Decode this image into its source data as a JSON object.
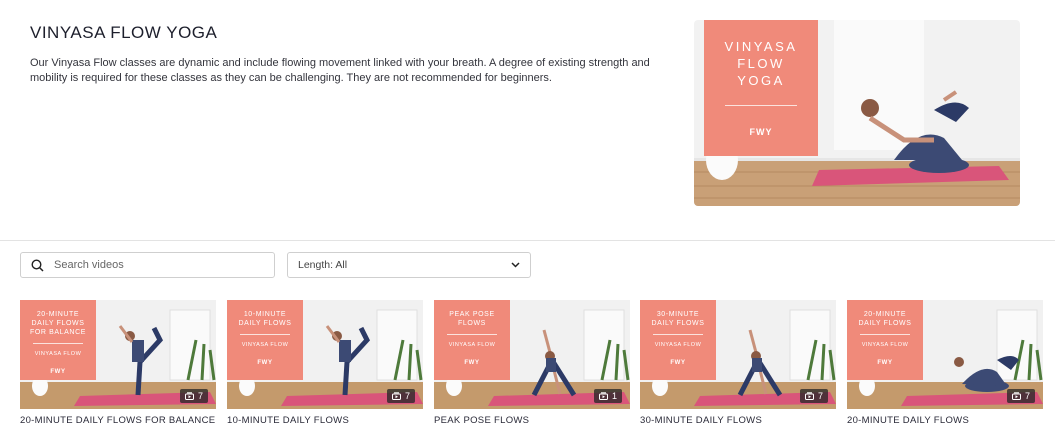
{
  "hero": {
    "title": "VINYASA FLOW YOGA",
    "description": "Our Vinyasa Flow classes are dynamic and include flowing movement linked with your breath. A degree of existing strength and mobility is required for these classes as they can be challenging. They are not recommended for beginners.",
    "image_overlay": {
      "title": "VINYASA FLOW YOGA",
      "logo": "FWY"
    }
  },
  "search": {
    "placeholder": "Search videos"
  },
  "filter": {
    "length_value": "Length: All"
  },
  "cards": [
    {
      "title": "20-MINUTE DAILY FLOWS FOR BALANCE",
      "overlay": "20-MINUTE DAILY FLOWS FOR BALANCE",
      "sub": "VINYASA FLOW",
      "logo": "FWY",
      "count": "7"
    },
    {
      "title": "10-MINUTE DAILY FLOWS",
      "overlay": "10-MINUTE DAILY FLOWS",
      "sub": "VINYASA FLOW",
      "logo": "FWY",
      "count": "7"
    },
    {
      "title": "PEAK POSE FLOWS",
      "overlay": "PEAK POSE FLOWS",
      "sub": "VINYASA FLOW",
      "logo": "FWY",
      "count": "1"
    },
    {
      "title": "30-MINUTE DAILY FLOWS",
      "overlay": "30-MINUTE DAILY FLOWS",
      "sub": "VINYASA FLOW",
      "logo": "FWY",
      "count": "7"
    },
    {
      "title": "20-MINUTE DAILY FLOWS",
      "overlay": "20-MINUTE DAILY FLOWS",
      "sub": "VINYASA FLOW",
      "logo": "FWY",
      "count": "7"
    }
  ],
  "colors": {
    "accent": "#f08a7a",
    "mat": "#d9557a",
    "floor": "#c49a6c",
    "wall": "#f1f1f1"
  }
}
